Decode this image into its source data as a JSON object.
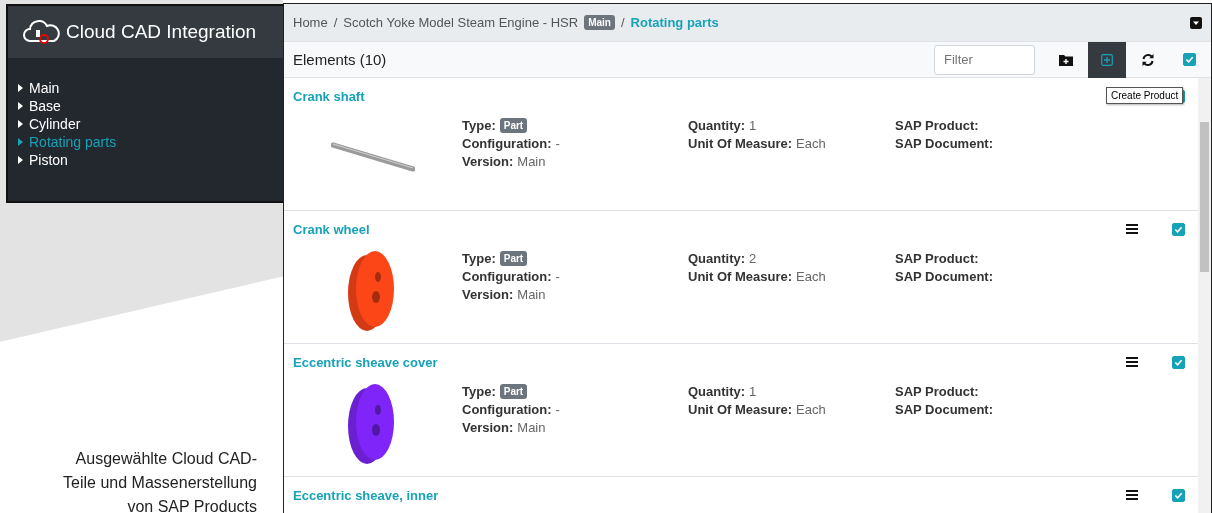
{
  "sidebar": {
    "title": "Cloud CAD Integration",
    "items": [
      {
        "label": "Main",
        "selected": false
      },
      {
        "label": "Base",
        "selected": false
      },
      {
        "label": "Cylinder",
        "selected": false
      },
      {
        "label": "Rotating parts",
        "selected": true
      },
      {
        "label": "Piston",
        "selected": false
      }
    ]
  },
  "caption": [
    "Ausgewählte Cloud CAD-",
    "Teile und Massenerstellung",
    "von SAP Products"
  ],
  "breadcrumb": [
    {
      "label": "Home",
      "current": false
    },
    {
      "separator": "/",
      "label": "Scotch Yoke Model Steam Engine - HSR",
      "badge": "Main",
      "current": false
    },
    {
      "separator": "/",
      "label": "Rotating parts",
      "current": true
    }
  ],
  "toolbar": {
    "title": "Elements (10)",
    "filter_placeholder": "Filter",
    "buttons": [
      {
        "kind": "add-folder",
        "hovered": false
      },
      {
        "kind": "create",
        "hovered": true,
        "tooltip": "Create Product"
      },
      {
        "kind": "refresh",
        "hovered": false
      }
    ],
    "checked": true
  },
  "elements": [
    {
      "name": "Crank shaft",
      "kind": "rod",
      "color": "#9a9a9a",
      "checked": true,
      "columns": [
        [
          {
            "label": "Type:",
            "value": "Part",
            "kind": "badge"
          },
          {
            "label": "Configuration:",
            "value": "-"
          },
          {
            "label": "Version:",
            "value": "Main"
          }
        ],
        [
          {
            "label": "Quantity:",
            "value": "1"
          },
          {
            "label": "Unit Of Measure:",
            "value": "Each"
          }
        ],
        [
          {
            "label": "SAP Product:"
          },
          {
            "label": "SAP Document:"
          }
        ]
      ]
    },
    {
      "name": "Crank wheel",
      "kind": "disc",
      "color": "#d33a14",
      "checked": true,
      "columns": [
        [
          {
            "label": "Type:",
            "value": "Part",
            "kind": "badge"
          },
          {
            "label": "Configuration:",
            "value": "-"
          },
          {
            "label": "Version:",
            "value": "Main"
          }
        ],
        [
          {
            "label": "Quantity:",
            "value": "2"
          },
          {
            "label": "Unit Of Measure:",
            "value": "Each"
          }
        ],
        [
          {
            "label": "SAP Product:"
          },
          {
            "label": "SAP Document:"
          }
        ]
      ]
    },
    {
      "name": "Eccentric sheave cover",
      "kind": "disc",
      "color": "#6a1fd0",
      "checked": true,
      "columns": [
        [
          {
            "label": "Type:",
            "value": "Part",
            "kind": "badge"
          },
          {
            "label": "Configuration:",
            "value": "-"
          },
          {
            "label": "Version:",
            "value": "Main"
          }
        ],
        [
          {
            "label": "Quantity:",
            "value": "1"
          },
          {
            "label": "Unit Of Measure:",
            "value": "Each"
          }
        ],
        [
          {
            "label": "SAP Product:"
          },
          {
            "label": "SAP Document:"
          }
        ]
      ]
    },
    {
      "name": "Eccentric sheave, inner",
      "checked": true
    }
  ]
}
